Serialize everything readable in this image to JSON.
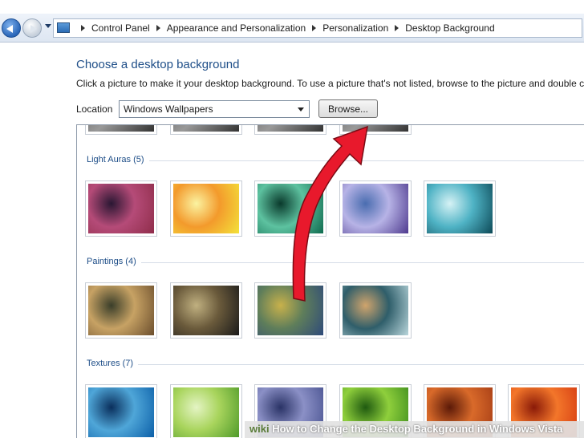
{
  "breadcrumb": {
    "items": [
      "Control Panel",
      "Appearance and Personalization",
      "Personalization",
      "Desktop Background"
    ]
  },
  "header": {
    "title": "Choose a desktop background",
    "description": "Click a picture to make it your desktop background. To use a picture that's not listed, browse to the picture and double click it."
  },
  "location": {
    "label": "Location",
    "selected": "Windows Wallpapers",
    "browse_label": "Browse..."
  },
  "groups": [
    {
      "name": "Light Auras (5)",
      "thumbs": [
        {
          "name": "light-auras-1",
          "colors": [
            "#8f2d4a",
            "#b54b78",
            "#2a1733"
          ]
        },
        {
          "name": "light-auras-2",
          "colors": [
            "#f3e23a",
            "#f39a2c",
            "#fbf3a1"
          ]
        },
        {
          "name": "light-auras-3",
          "colors": [
            "#0f6b4f",
            "#5dc2a0",
            "#0a3a2c"
          ]
        },
        {
          "name": "light-auras-4",
          "colors": [
            "#4e3a8e",
            "#b7b3e6",
            "#4a6db0"
          ]
        },
        {
          "name": "light-auras-5",
          "colors": [
            "#0c4957",
            "#4fb3c5",
            "#d6f2f5"
          ]
        }
      ]
    },
    {
      "name": "Paintings (4)",
      "thumbs": [
        {
          "name": "paintings-1",
          "colors": [
            "#6b4e2d",
            "#c7a264",
            "#3a3e2a"
          ]
        },
        {
          "name": "paintings-2",
          "colors": [
            "#1a1a1a",
            "#6a5a3b",
            "#c0b080"
          ]
        },
        {
          "name": "paintings-3",
          "colors": [
            "#2e4a7a",
            "#5f7e5a",
            "#c8b14b"
          ]
        },
        {
          "name": "paintings-4",
          "colors": [
            "#b9d6dc",
            "#2f5e6a",
            "#d0a46c"
          ]
        }
      ]
    },
    {
      "name": "Textures (7)",
      "thumbs": [
        {
          "name": "textures-1",
          "colors": [
            "#0b5fa8",
            "#4fa6d8",
            "#0a2f5c"
          ]
        },
        {
          "name": "textures-2",
          "colors": [
            "#4f9a2a",
            "#a8d45c",
            "#e4f4c4"
          ]
        },
        {
          "name": "textures-3",
          "colors": [
            "#46508e",
            "#8b90c6",
            "#2a3366"
          ]
        },
        {
          "name": "textures-4",
          "colors": [
            "#3a8a1c",
            "#8fcf3c",
            "#1f5a10"
          ]
        },
        {
          "name": "textures-5",
          "colors": [
            "#a23a14",
            "#d96a2a",
            "#5c1a08"
          ]
        },
        {
          "name": "textures-6",
          "colors": [
            "#d43a12",
            "#f3762a",
            "#8a1a08"
          ]
        }
      ]
    }
  ],
  "annotation": {
    "arrow_color": "#e8192c"
  },
  "banner": {
    "logo": "wiki",
    "text": "How to Change the Desktop Background in Windows Vista"
  }
}
